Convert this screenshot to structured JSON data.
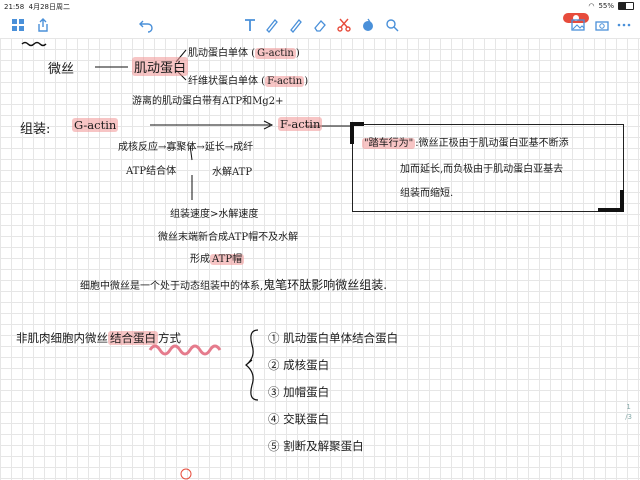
{
  "status": {
    "time": "21:58",
    "date": "4月28日周二",
    "battery": "55%"
  },
  "toolbar": {
    "left_icons": [
      "grid-icon",
      "share-icon",
      "undo-icon"
    ],
    "center_icons": [
      "text-tool-icon",
      "pen-icon",
      "pencil-icon",
      "eraser-icon",
      "scissors-icon",
      "color-dropper-icon",
      "lasso-icon"
    ],
    "right_icons": [
      "record-icon",
      "image-icon",
      "camera-icon",
      "more-icon"
    ]
  },
  "note": {
    "weisi": "微丝",
    "actin": "肌动蛋白",
    "g_line": "肌动蛋白单体",
    "g_label": "G-actin",
    "f_line": "纤维状蛋白单体",
    "f_label": "F-actin",
    "atp_line": "游离的肌动蛋白带有ATP和Mg2+",
    "zuzhuang": "组装:",
    "g_actin": "G-actin",
    "f_actin": "F-actin",
    "step1": "成核反应→寡聚体→延长→成纤",
    "step2": "ATP结合体",
    "step3": "水解ATP",
    "step4": "组装速度>水解速度",
    "step5": "微丝末端新合成ATP帽不及水解",
    "step6": "形成",
    "step6b": "ATP帽",
    "step7": "细胞中微丝是一个处于动态组装中的体系",
    "step7b": "鬼笔环肽影响微丝组装.",
    "box_title": "\"踏车行为\"",
    "box_l1": "微丝正极由于肌动蛋白亚基不断添",
    "box_l2": "加而延长,而负极由于肌动蛋白亚基去",
    "box_l3": "组装而缩短.",
    "bind_title_a": "非肌肉细胞内微丝",
    "bind_title_b": "结合蛋白",
    "bind_title_c": "方式",
    "bind_items": [
      "① 肌动蛋白单体结合蛋白",
      "② 成核蛋白",
      "③ 加帽蛋白",
      "④ 交联蛋白",
      "⑤ 割断及解聚蛋白"
    ],
    "bottom_mark": "①"
  },
  "pager": {
    "current": "1",
    "total": "/3"
  }
}
